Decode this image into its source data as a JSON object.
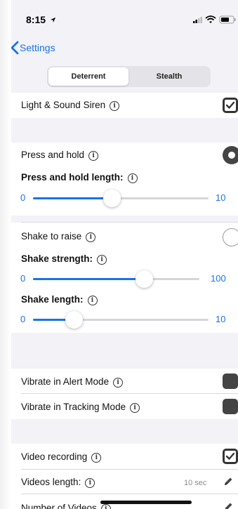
{
  "status_bar": {
    "time": "8:15"
  },
  "nav": {
    "back_label": "Settings"
  },
  "segments": {
    "active": "Deterrent",
    "inactive": "Stealth"
  },
  "rows": {
    "siren": {
      "label": "Light & Sound Siren",
      "checked": true
    },
    "press_hold": {
      "label": "Press and hold",
      "selected": true
    },
    "press_hold_length": {
      "label": "Press and hold length:",
      "min": "0",
      "max": "10",
      "value": 0.45
    },
    "shake_raise": {
      "label": "Shake to raise",
      "selected": false
    },
    "shake_strength": {
      "label": "Shake strength:",
      "min": "0",
      "max": "100",
      "value": 0.67
    },
    "shake_length": {
      "label": "Shake length:",
      "min": "0",
      "max": "10",
      "value": 0.24
    },
    "vibrate_alert": {
      "label": "Vibrate in Alert Mode",
      "checked": false
    },
    "vibrate_tracking": {
      "label": "Vibrate in Tracking Mode",
      "checked": false
    },
    "video_recording": {
      "label": "Video recording",
      "checked": true
    },
    "videos_length": {
      "label": "Videos length:",
      "value": "10 sec"
    },
    "number_videos": {
      "label": "Number of Videos"
    }
  },
  "info_glyph": "i",
  "colors": {
    "accent": "#1a73e8",
    "background": "#f2f2f7"
  }
}
